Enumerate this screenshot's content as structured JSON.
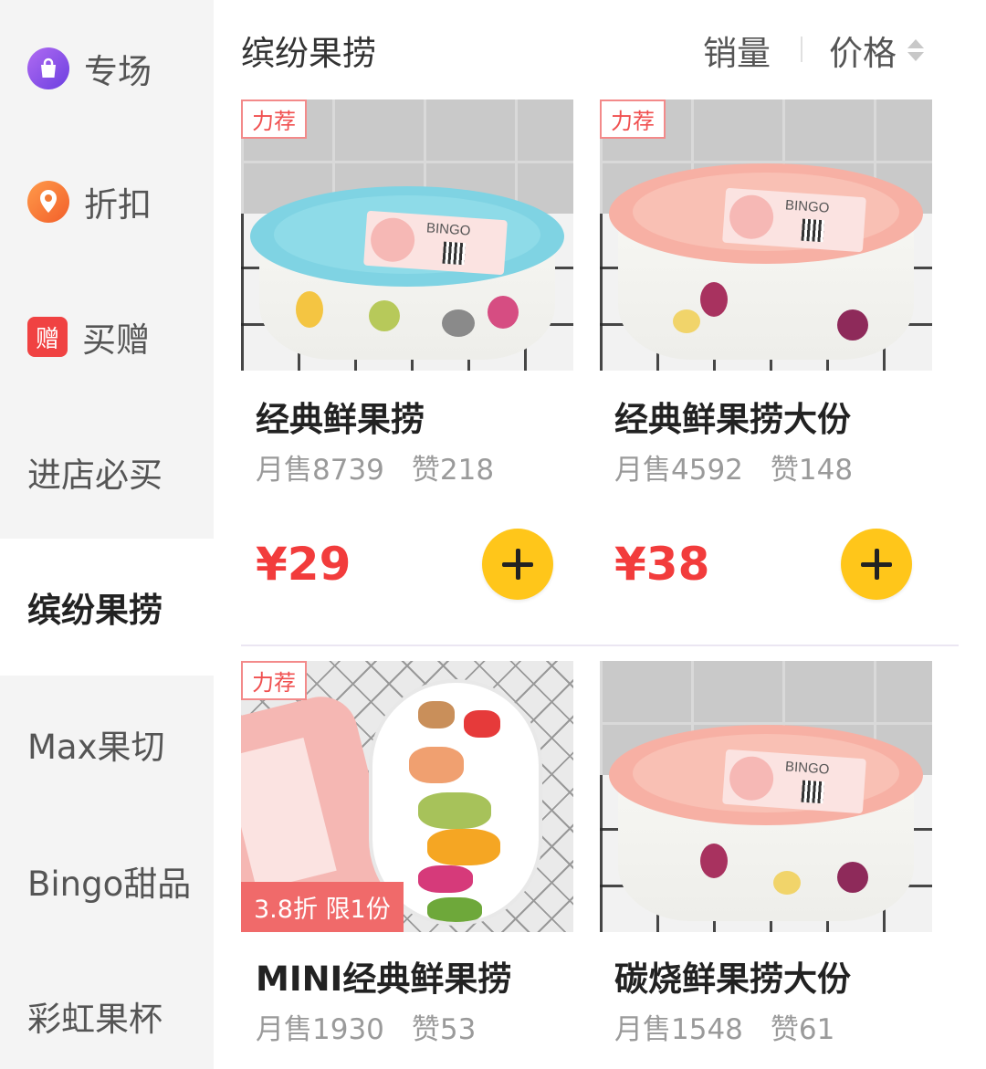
{
  "sidebar": {
    "items": [
      {
        "label": "专场",
        "icon": "shopping-bag-icon"
      },
      {
        "label": "折扣",
        "icon": "location-pin-icon"
      },
      {
        "label": "买赠",
        "icon_text": "赠"
      },
      {
        "label": "进店必买"
      },
      {
        "label": "缤纷果捞",
        "active": true
      },
      {
        "label": "Max果切"
      },
      {
        "label": "Bingo甜品"
      },
      {
        "label": "彩虹果杯"
      }
    ]
  },
  "header": {
    "category_title": "缤纷果捞",
    "sort_sales": "销量",
    "sort_price": "价格"
  },
  "products": [
    {
      "name": "经典鲜果捞",
      "tag": "力荐",
      "sales": "月售8739",
      "likes": "赞218",
      "price": "¥29",
      "lid_color": "#7fd3e3"
    },
    {
      "name": "经典鲜果捞大份",
      "tag": "力荐",
      "sales": "月售4592",
      "likes": "赞148",
      "price": "¥38",
      "lid_color": "#f7b0a4"
    },
    {
      "name": "MINI经典鲜果捞",
      "tag": "力荐",
      "discount": "3.8折 限1份",
      "sales": "月售1930",
      "likes": "赞53"
    },
    {
      "name": "碳烧鲜果捞大份",
      "sales": "月售1548",
      "likes": "赞61",
      "lid_color": "#f7b0a4"
    }
  ],
  "photo_label_text": "BINGO",
  "colors": {
    "price_red": "#f23c3c",
    "add_button_yellow": "#ffc61a",
    "tag_red": "#f05050",
    "active_sidebar_bg": "#ffffff",
    "sidebar_bg": "#f4f4f4"
  }
}
